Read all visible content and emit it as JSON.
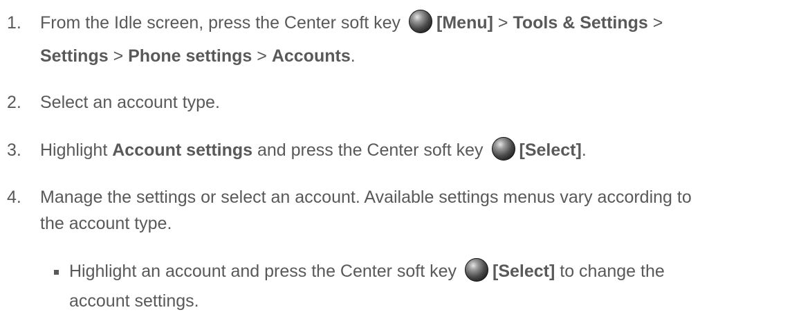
{
  "steps": [
    {
      "number": "1.",
      "line1": {
        "t1": "From the Idle screen, press the Center soft key ",
        "b1": "[Menu]",
        "t2": " > ",
        "b2": "Tools & Settings",
        "t3": " >"
      },
      "line2": {
        "b1": "Settings",
        "t1": " > ",
        "b2": "Phone settings",
        "t2": " > ",
        "b3": "Accounts",
        "t3": "."
      }
    },
    {
      "number": "2.",
      "text": "Select an account type."
    },
    {
      "number": "3.",
      "t1": "Highlight ",
      "b1": "Account settings",
      "t2": " and press the Center soft key ",
      "b2": "[Select]",
      "t3": "."
    },
    {
      "number": "4.",
      "line1": "Manage the settings or select an account. Available settings menus vary according to",
      "line2": "the account type."
    }
  ],
  "sub_bullet": {
    "t1": "Highlight an account and press the Center soft key ",
    "b1": "[Select]",
    "t2": " to change the",
    "line2": "account settings."
  },
  "icons": {
    "center_key": "center-soft-key-icon"
  },
  "colors": {
    "text": "#595959"
  }
}
